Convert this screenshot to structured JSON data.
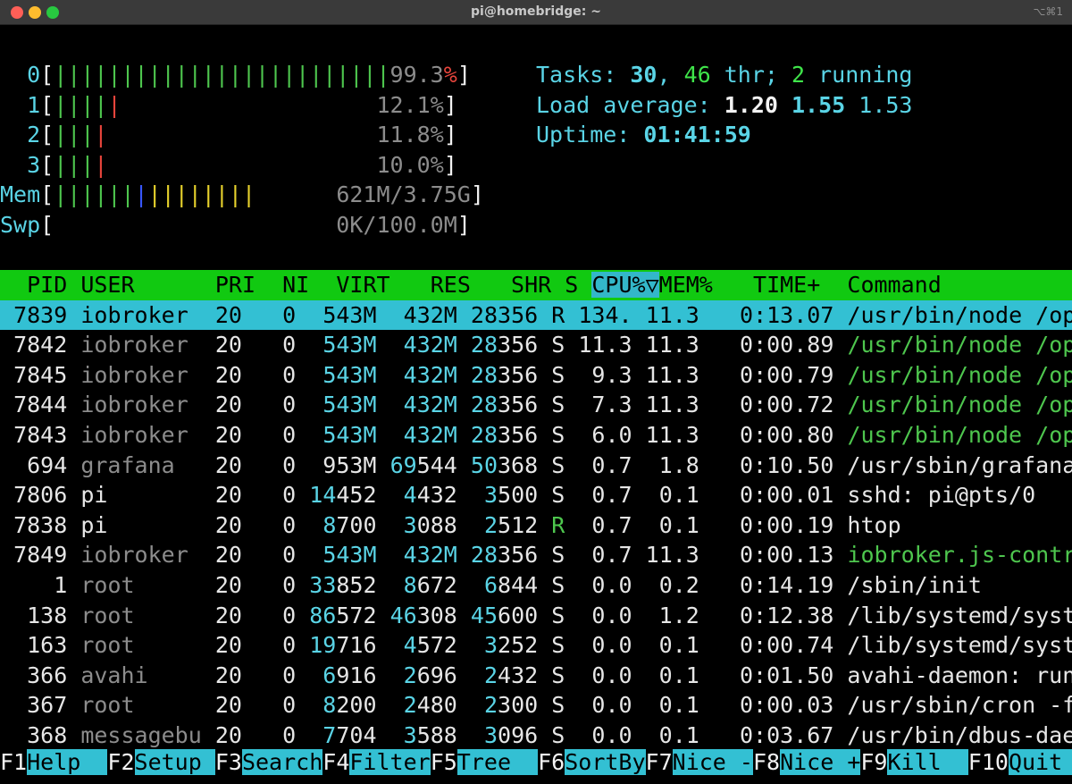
{
  "window": {
    "title": "pi@homebridge: ~",
    "shortcut": "⌥⌘1"
  },
  "meters": {
    "cpu": [
      {
        "label": "0",
        "bar_green": "|||||||||||||||||||||||||",
        "bar_red": "",
        "value": "99.3",
        "unit": "%",
        "pct": 99.3
      },
      {
        "label": "1",
        "bar_green": "||||",
        "bar_red": "|",
        "value": "12.1%",
        "pct": 12.1
      },
      {
        "label": "2",
        "bar_green": "|||",
        "bar_red": "|",
        "value": "11.8%",
        "pct": 11.8
      },
      {
        "label": "3",
        "bar_green": "|||",
        "bar_red": "|",
        "value": "10.0%",
        "pct": 10.0
      }
    ],
    "mem": {
      "label": "Mem",
      "bar_green": "||||||",
      "bar_blue": "|",
      "bar_yellow": "||||||||",
      "value": "621M/3.75G"
    },
    "swp": {
      "label": "Swp",
      "value": "0K/100.0M"
    }
  },
  "summary": {
    "tasks_label": "Tasks: ",
    "tasks": "30",
    "sep1": ", ",
    "threads": "46",
    "thr_label": " thr; ",
    "running": "2",
    "running_label": " running",
    "load_label": "Load average: ",
    "load1": "1.20",
    "load5": "1.55",
    "load15": "1.53",
    "uptime_label": "Uptime: ",
    "uptime": "01:41:59"
  },
  "table": {
    "headers": {
      "pid": "PID",
      "user": "USER",
      "pri": "PRI",
      "ni": "NI",
      "virt": "VIRT",
      "res": "RES",
      "shr": "SHR",
      "s": "S",
      "cpu": "CPU%▽",
      "mem": "MEM%",
      "time": "TIME+",
      "command": "Command"
    },
    "rows": [
      {
        "pid": "7839",
        "user": "iobroker",
        "pri": "20",
        "ni": "0",
        "virt": "543M",
        "res": "432M",
        "shr_hi": "28",
        "shr_lo": "356",
        "s": "R",
        "cpu": "134.",
        "mem": "11.3",
        "time": "0:13.07",
        "command": "/usr/bin/node /op",
        "selected": true
      },
      {
        "pid": "7842",
        "user": "iobroker",
        "pri": "20",
        "ni": "0",
        "virt": "543M",
        "res": "432M",
        "shr_hi": "28",
        "shr_lo": "356",
        "s": "S",
        "cpu": "11.3",
        "mem": "11.3",
        "time": "0:00.89",
        "command": "/usr/bin/node /op",
        "thread": true
      },
      {
        "pid": "7845",
        "user": "iobroker",
        "pri": "20",
        "ni": "0",
        "virt": "543M",
        "res": "432M",
        "shr_hi": "28",
        "shr_lo": "356",
        "s": "S",
        "cpu": "9.3",
        "mem": "11.3",
        "time": "0:00.79",
        "command": "/usr/bin/node /op",
        "thread": true
      },
      {
        "pid": "7844",
        "user": "iobroker",
        "pri": "20",
        "ni": "0",
        "virt": "543M",
        "res": "432M",
        "shr_hi": "28",
        "shr_lo": "356",
        "s": "S",
        "cpu": "7.3",
        "mem": "11.3",
        "time": "0:00.72",
        "command": "/usr/bin/node /op",
        "thread": true
      },
      {
        "pid": "7843",
        "user": "iobroker",
        "pri": "20",
        "ni": "0",
        "virt": "543M",
        "res": "432M",
        "shr_hi": "28",
        "shr_lo": "356",
        "s": "S",
        "cpu": "6.0",
        "mem": "11.3",
        "time": "0:00.80",
        "command": "/usr/bin/node /op",
        "thread": true
      },
      {
        "pid": "694",
        "user": "grafana",
        "pri": "20",
        "ni": "0",
        "virt": "953M",
        "res_hi": "69",
        "res_lo": "544",
        "shr_hi": "50",
        "shr_lo": "368",
        "s": "S",
        "cpu": "0.7",
        "mem": "1.8",
        "time": "0:10.50",
        "command": "/usr/sbin/grafana"
      },
      {
        "pid": "7806",
        "user": "pi",
        "pri": "20",
        "ni": "0",
        "virt_hi": "14",
        "virt_lo": "452",
        "res_hi": "4",
        "res_lo": "432",
        "shr_hi": "3",
        "shr_lo": "500",
        "s": "S",
        "cpu": "0.7",
        "mem": "0.1",
        "time": "0:00.01",
        "command": "sshd: pi@pts/0",
        "user_white": true
      },
      {
        "pid": "7838",
        "user": "pi",
        "pri": "20",
        "ni": "0",
        "virt_hi": "8",
        "virt_lo": "700",
        "res_hi": "3",
        "res_lo": "088",
        "shr_hi": "2",
        "shr_lo": "512",
        "s": "R",
        "cpu": "0.7",
        "mem": "0.1",
        "time": "0:00.19",
        "command": "htop",
        "user_white": true,
        "s_green": true
      },
      {
        "pid": "7849",
        "user": "iobroker",
        "pri": "20",
        "ni": "0",
        "virt": "543M",
        "res": "432M",
        "shr_hi": "28",
        "shr_lo": "356",
        "s": "S",
        "cpu": "0.7",
        "mem": "11.3",
        "time": "0:00.13",
        "command": "iobroker.js-contr",
        "thread": true
      },
      {
        "pid": "1",
        "user": "root",
        "pri": "20",
        "ni": "0",
        "virt_hi": "33",
        "virt_lo": "852",
        "res_hi": "8",
        "res_lo": "672",
        "shr_hi": "6",
        "shr_lo": "844",
        "s": "S",
        "cpu": "0.0",
        "mem": "0.2",
        "time": "0:14.19",
        "command": "/sbin/init"
      },
      {
        "pid": "138",
        "user": "root",
        "pri": "20",
        "ni": "0",
        "virt_hi": "86",
        "virt_lo": "572",
        "res_hi": "46",
        "res_lo": "308",
        "shr_hi": "45",
        "shr_lo": "600",
        "s": "S",
        "cpu": "0.0",
        "mem": "1.2",
        "time": "0:12.38",
        "command": "/lib/systemd/syst"
      },
      {
        "pid": "163",
        "user": "root",
        "pri": "20",
        "ni": "0",
        "virt_hi": "19",
        "virt_lo": "716",
        "res_hi": "4",
        "res_lo": "572",
        "shr_hi": "3",
        "shr_lo": "252",
        "s": "S",
        "cpu": "0.0",
        "mem": "0.1",
        "time": "0:00.74",
        "command": "/lib/systemd/syst"
      },
      {
        "pid": "366",
        "user": "avahi",
        "pri": "20",
        "ni": "0",
        "virt_hi": "6",
        "virt_lo": "916",
        "res_hi": "2",
        "res_lo": "696",
        "shr_hi": "2",
        "shr_lo": "432",
        "s": "S",
        "cpu": "0.0",
        "mem": "0.1",
        "time": "0:01.50",
        "command": "avahi-daemon: run"
      },
      {
        "pid": "367",
        "user": "root",
        "pri": "20",
        "ni": "0",
        "virt_hi": "8",
        "virt_lo": "200",
        "res_hi": "2",
        "res_lo": "480",
        "shr_hi": "2",
        "shr_lo": "300",
        "s": "S",
        "cpu": "0.0",
        "mem": "0.1",
        "time": "0:00.03",
        "command": "/usr/sbin/cron -f"
      },
      {
        "pid": "368",
        "user": "messagebu",
        "pri": "20",
        "ni": "0",
        "virt_hi": "7",
        "virt_lo": "704",
        "res_hi": "3",
        "res_lo": "588",
        "shr_hi": "3",
        "shr_lo": "096",
        "s": "S",
        "cpu": "0.0",
        "mem": "0.1",
        "time": "0:03.67",
        "command": "/usr/bin/dbus-dae"
      }
    ]
  },
  "fkeys": [
    {
      "key": "F1",
      "label": "Help  "
    },
    {
      "key": "F2",
      "label": "Setup "
    },
    {
      "key": "F3",
      "label": "Search"
    },
    {
      "key": "F4",
      "label": "Filter"
    },
    {
      "key": "F5",
      "label": "Tree  "
    },
    {
      "key": "F6",
      "label": "SortBy"
    },
    {
      "key": "F7",
      "label": "Nice -"
    },
    {
      "key": "F8",
      "label": "Nice +"
    },
    {
      "key": "F9",
      "label": "Kill  "
    },
    {
      "key": "F10",
      "label": "Quit  "
    }
  ],
  "colors": {
    "accent_cyan": "#33c0d3",
    "header_green": "#11c911",
    "bar_green": "#4ec64e",
    "bar_red": "#e8453c"
  }
}
